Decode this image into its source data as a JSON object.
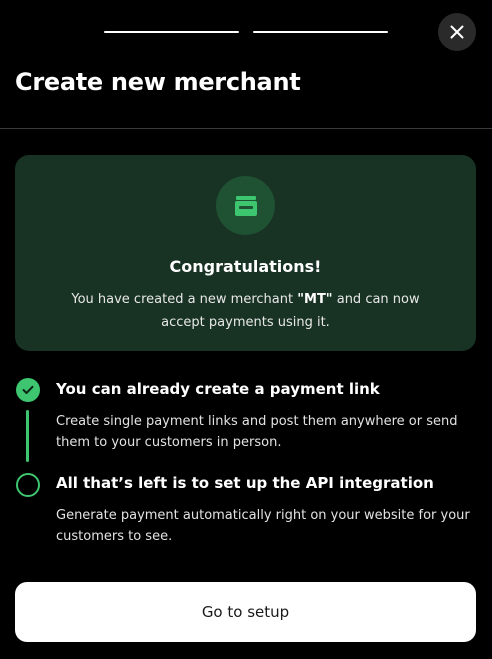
{
  "modal": {
    "title": "Create new merchant",
    "close_icon": "close-icon",
    "progress_steps": 2
  },
  "success_card": {
    "icon": "store-icon",
    "heading": "Congratulations!",
    "message_prefix": "You have created a new merchant ",
    "merchant_name": "\"MT\"",
    "message_suffix": " and can now accept payments using it."
  },
  "steps": [
    {
      "status": "done",
      "icon": "check-icon",
      "title": "You can already create a payment link",
      "description": "Create single payment links and post them anywhere or send them to your customers in person."
    },
    {
      "status": "pending",
      "icon": "empty-circle-icon",
      "title": "All that’s left is to set up the API integration",
      "description": "Generate payment automatically right on your website for your customers to see."
    }
  ],
  "footer": {
    "button_label": "Go to setup"
  },
  "colors": {
    "background": "#000000",
    "card": "#183324",
    "accent": "#3ec56f",
    "button": "#ffffff"
  }
}
